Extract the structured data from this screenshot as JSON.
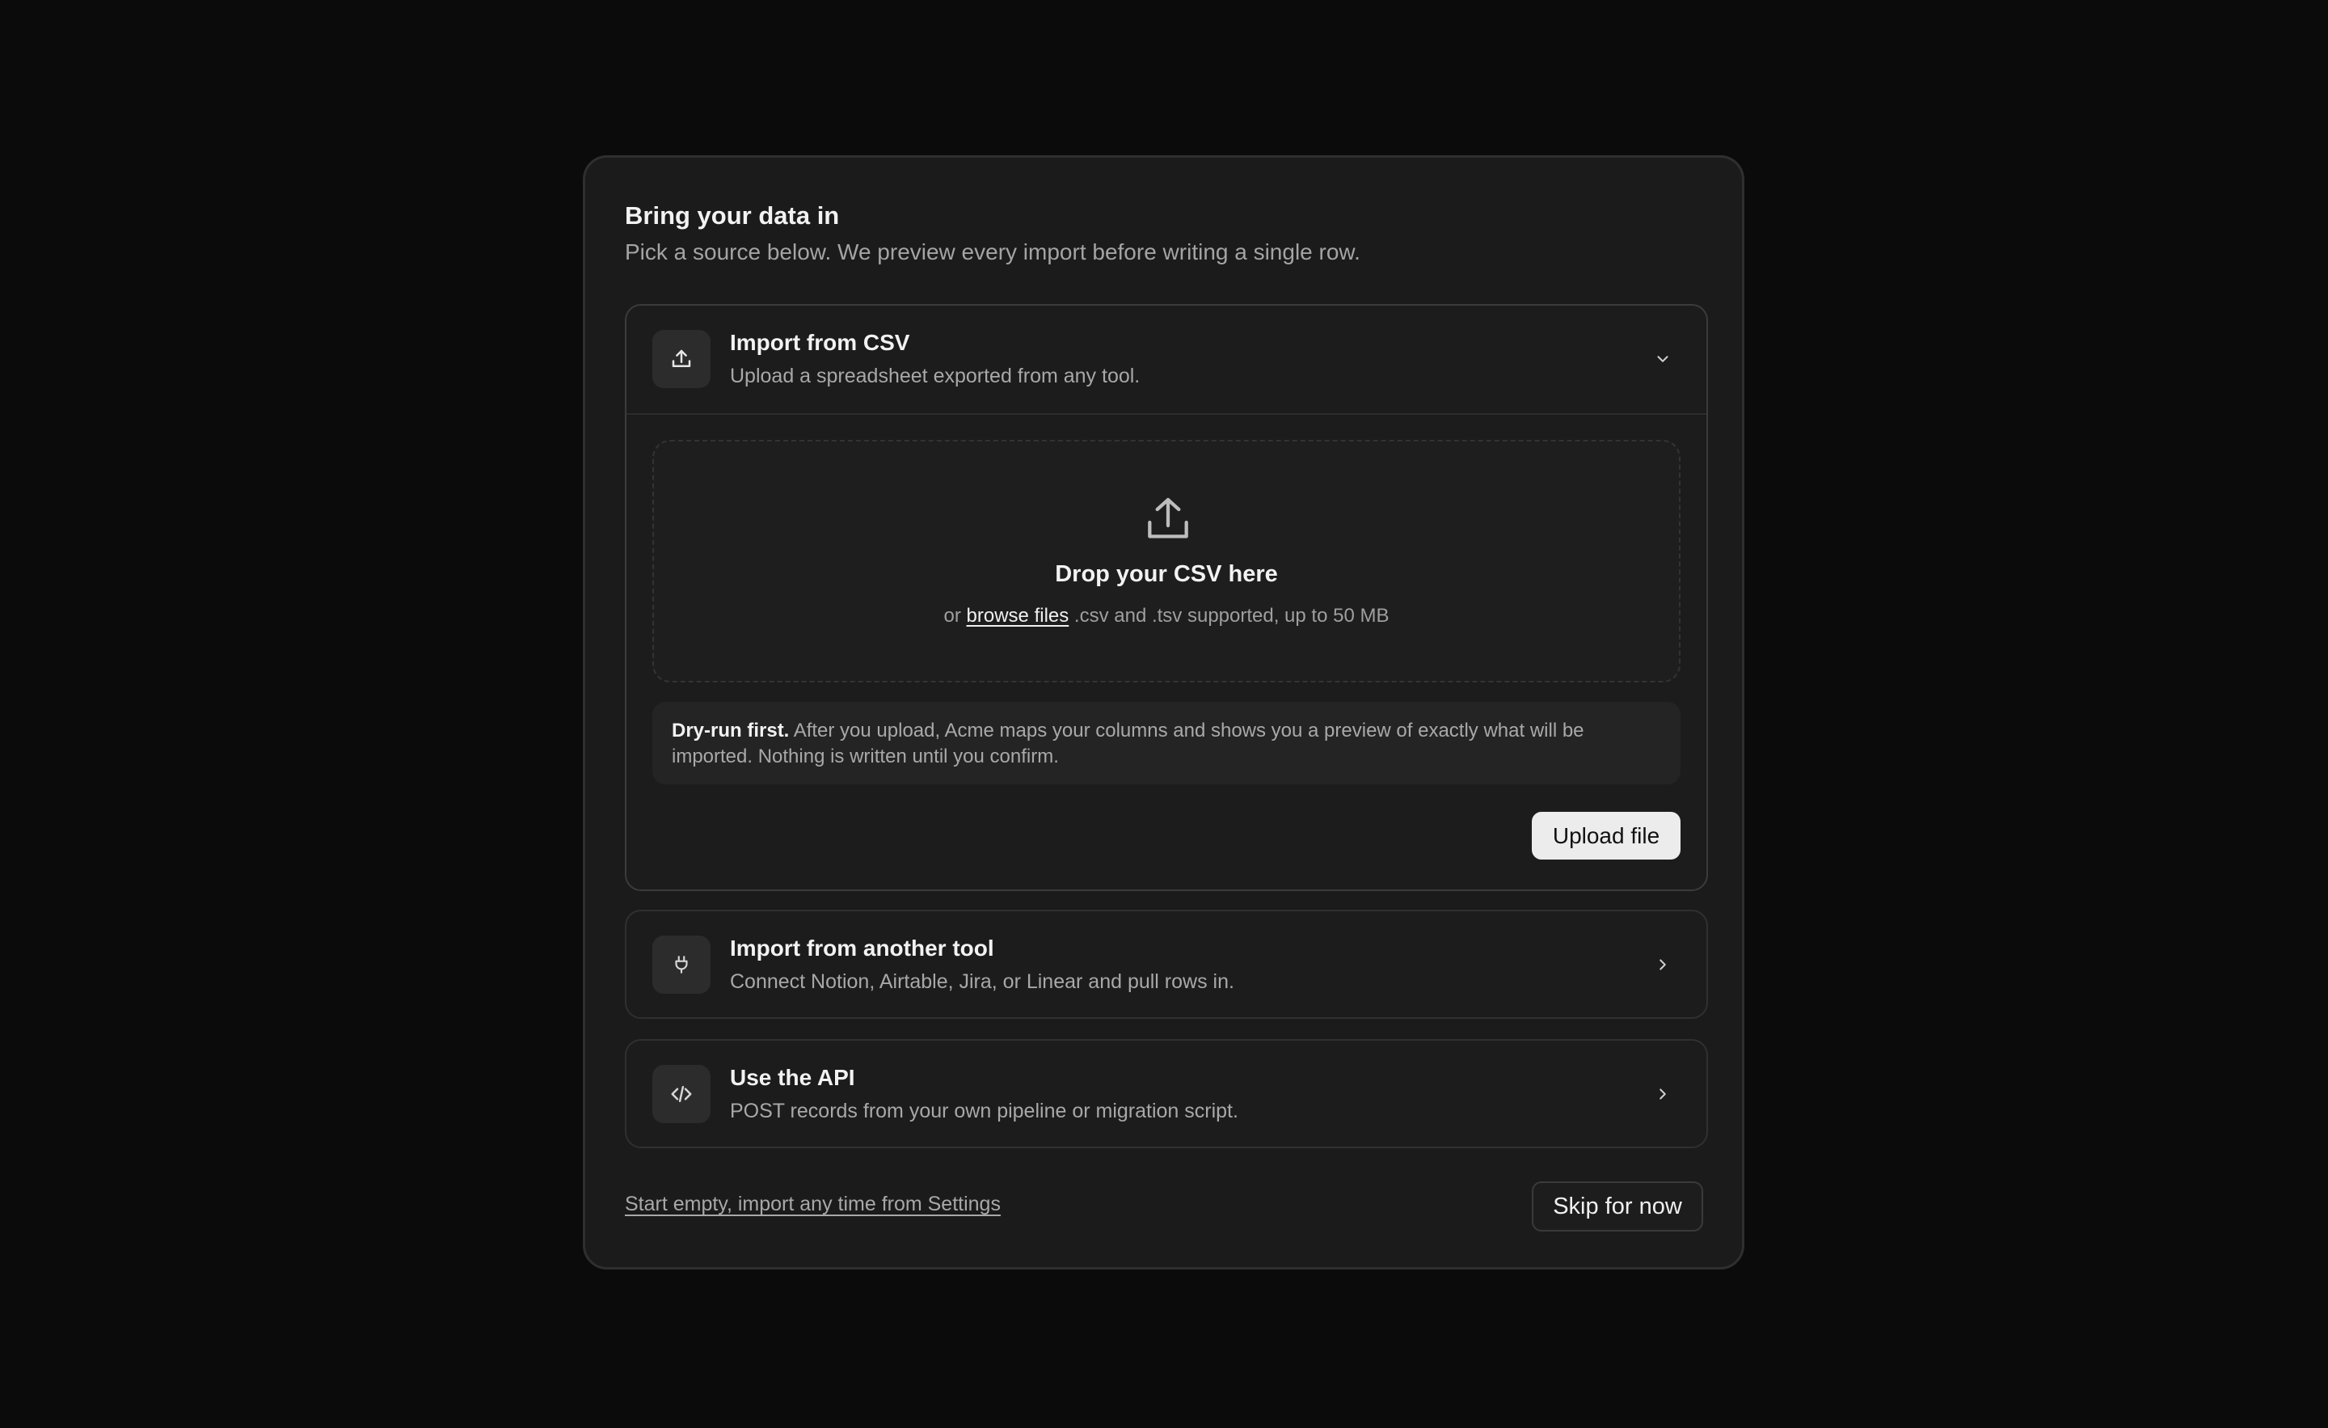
{
  "dialog": {
    "title": "Bring your data in",
    "subtitle": "Pick a source below. We preview every import before writing a single row."
  },
  "options": [
    {
      "title": "Import from CSV",
      "description": "Upload a spreadsheet exported from any tool.",
      "icon": "upload-icon",
      "expanded": true,
      "chevron": "chevron-down-icon"
    },
    {
      "title": "Import from another tool",
      "description": "Connect Notion, Airtable, Jira, or Linear and pull rows in.",
      "icon": "plug-icon",
      "expanded": false,
      "chevron": "chevron-right-icon"
    },
    {
      "title": "Use the API",
      "description": "POST records from your own pipeline or migration script.",
      "icon": "code-icon",
      "expanded": false,
      "chevron": "chevron-right-icon"
    }
  ],
  "dropzone": {
    "title": "Drop your CSV here",
    "prefix": "or",
    "browse_link": "browse files",
    "formats": ".csv and .tsv supported, up to 50 MB"
  },
  "note": {
    "lead": "Dry-run first.",
    "body": "After you upload, Acme maps your columns and shows you a preview of exactly what will be imported. Nothing is written until you confirm."
  },
  "buttons": {
    "upload": "Upload file",
    "skip": "Skip for now"
  },
  "footer": {
    "link": "Start empty, import any time from Settings"
  },
  "colors": {
    "background": "#0b0b0b",
    "card": "#1b1b1b",
    "primary_button": "#ececec"
  }
}
